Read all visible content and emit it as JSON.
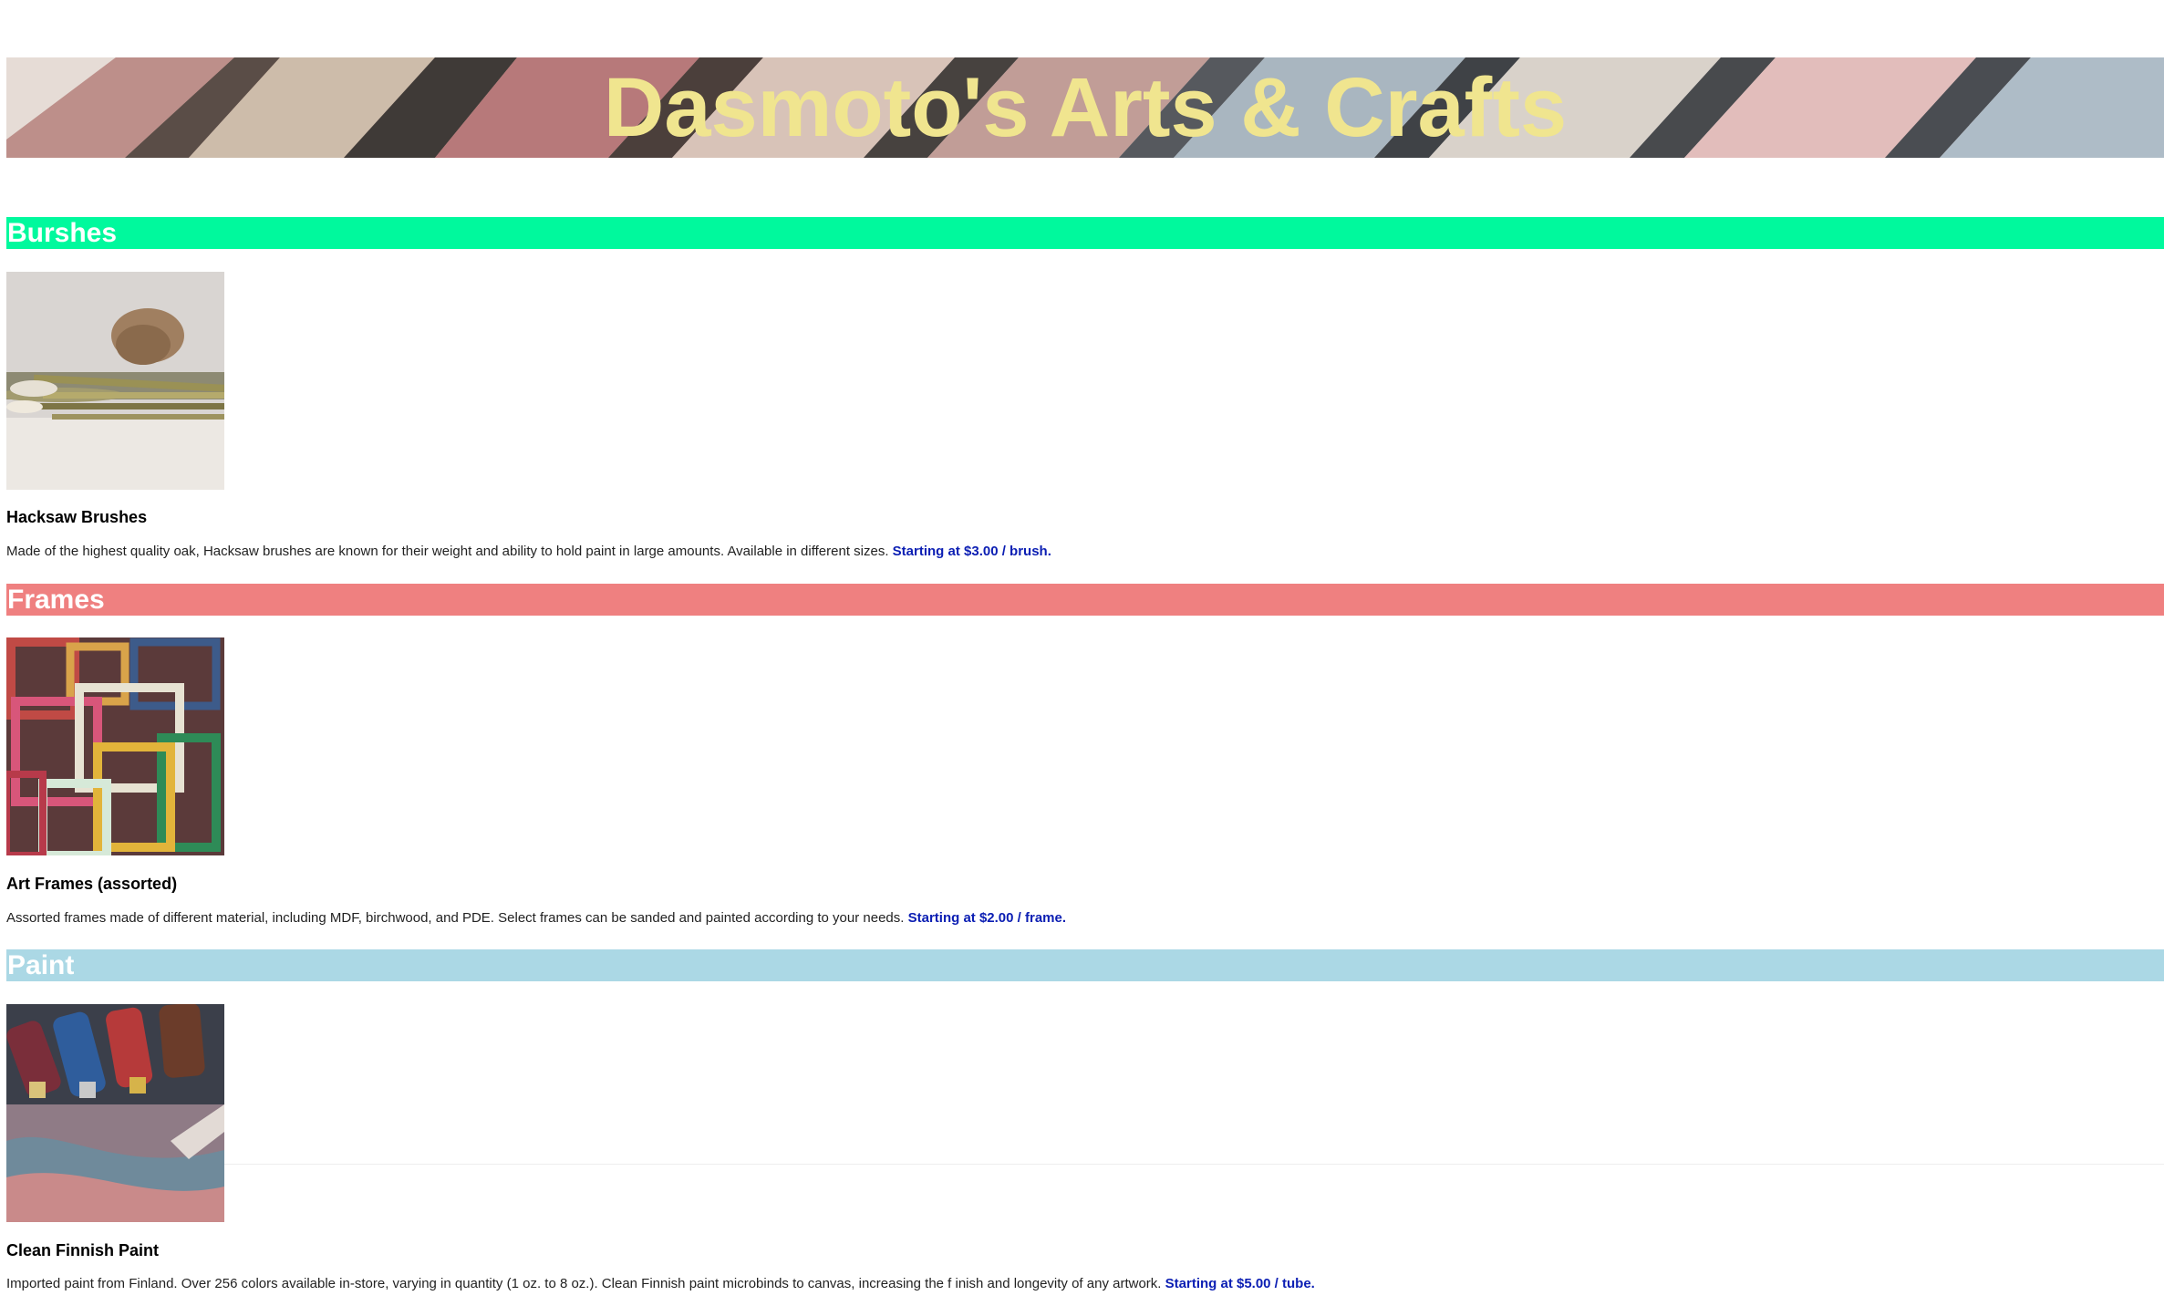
{
  "header": {
    "title": "Dasmoto's Arts & Crafts"
  },
  "colors": {
    "title": "#f0e58f",
    "brushes_bar": "#00f99d",
    "frames_bar": "#ef8080",
    "paint_bar": "#abd8e5",
    "price": "#0b1eb3"
  },
  "sections": [
    {
      "heading": "Burshes",
      "image_icon": "brushes-photo",
      "item_title": "Hacksaw Brushes",
      "description": "Made of the highest quality oak, Hacksaw brushes are known for their weight and ability to hold paint in large amounts. Available in different sizes.",
      "price": "Starting at $3.00 / brush."
    },
    {
      "heading": "Frames",
      "image_icon": "frames-photo",
      "item_title": "Art Frames (assorted)",
      "description": "Assorted frames made of different material, including MDF, birchwood, and PDE. Select frames can be sanded and painted according to your needs.",
      "price": "Starting at $2.00 / frame."
    },
    {
      "heading": "Paint",
      "image_icon": "paint-tubes-photo",
      "item_title": "Clean Finnish Paint",
      "description": "Imported paint from Finland. Over 256 colors available in-store, varying in quantity (1 oz. to 8 oz.). Clean Finnish paint microbinds to canvas, increasing the f inish and longevity of any artwork.",
      "price": "Starting at $5.00 / tube."
    }
  ]
}
